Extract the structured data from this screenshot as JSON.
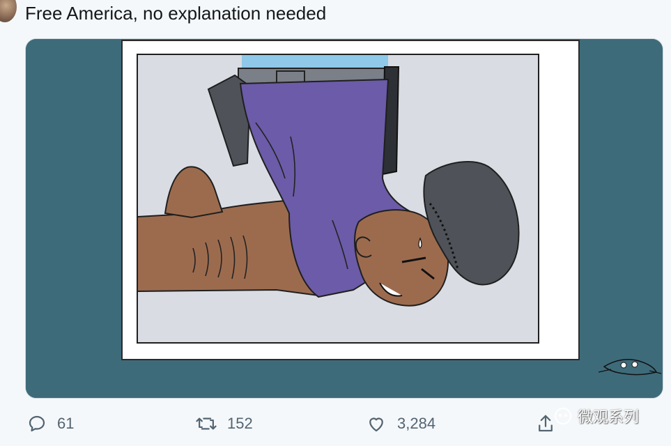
{
  "tweet": {
    "text": "Free America, no explanation needed"
  },
  "media": {
    "description_icon": "cartoon-image",
    "colors": {
      "background": "#3e6b7a",
      "frame": "#ffffff",
      "inner_panel": "#d9dce3",
      "uniform": "#6b5ba8",
      "skin": "#9c6b4e",
      "boot": "#4f5359"
    }
  },
  "actions": {
    "reply": {
      "icon": "reply-icon",
      "count": "61"
    },
    "retweet": {
      "icon": "retweet-icon",
      "count": "152"
    },
    "like": {
      "icon": "heart-icon",
      "count": "3,284"
    },
    "share": {
      "icon": "share-icon"
    }
  },
  "watermark": {
    "text": "微观系列"
  }
}
